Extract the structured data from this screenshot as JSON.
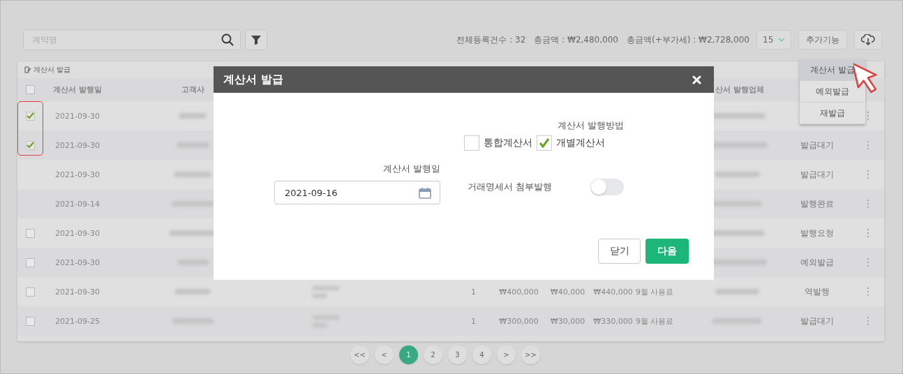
{
  "toolbar": {
    "search": {
      "placeholder": "계약명"
    },
    "stats": [
      "전체등록건수 : 32",
      "총금액 : ₩2,480,000",
      "총금액(+부가세) : ₩2,728,000"
    ],
    "page_size": "15",
    "more_button": "추가기능"
  },
  "table": {
    "action": "계산서 발급",
    "header": {
      "checked": false,
      "date": "계산서 발행일",
      "client": "고객사",
      "issuer": "산서 발행업체"
    },
    "rows": [
      {
        "has_checkbox": true,
        "checked": true,
        "date": "2021-09-30"
      },
      {
        "has_checkbox": true,
        "checked": true,
        "date": "2021-09-30",
        "status": "발급대기"
      },
      {
        "has_checkbox": false,
        "date": "2021-09-30",
        "status": "발급대기"
      },
      {
        "has_checkbox": false,
        "date": "2021-09-14",
        "status": "발행완료"
      },
      {
        "has_checkbox": true,
        "checked": false,
        "date": "2021-09-30",
        "status": "발행요청"
      },
      {
        "has_checkbox": true,
        "checked": false,
        "date": "2021-09-30",
        "status": "예외발급"
      },
      {
        "has_checkbox": true,
        "checked": false,
        "date": "2021-09-30",
        "qty": "1",
        "supply": "₩400,000",
        "tax": "₩40,000",
        "total": "₩440,000",
        "item": "9월 사용료",
        "status": "역발행"
      },
      {
        "has_checkbox": true,
        "checked": false,
        "date": "2021-09-25",
        "qty": "1",
        "supply": "₩300,000",
        "tax": "₩30,000",
        "total": "₩330,000",
        "item": "9월 사용료",
        "status": "발급대기"
      }
    ]
  },
  "pagination": {
    "first": "<<",
    "prev": "<",
    "pages": [
      {
        "label": "1",
        "selected": true
      },
      {
        "label": "2",
        "selected": false
      },
      {
        "label": "3",
        "selected": false
      },
      {
        "label": "4",
        "selected": false
      }
    ],
    "next": ">",
    "last": ">>"
  },
  "dropdown": {
    "items": [
      {
        "label": "계산서 발급",
        "selected": true
      },
      {
        "label": "예외발급",
        "selected": false
      },
      {
        "label": "재발급",
        "selected": false
      }
    ]
  },
  "modal": {
    "title": "계산서 발급",
    "date_label": "계산서 발행일",
    "date_value": "2021-09-16",
    "method_label": "계산서 발행방법",
    "methods": [
      {
        "label": "통합계산서",
        "checked": false
      },
      {
        "label": "개별계산서",
        "checked": true
      }
    ],
    "attach": {
      "label": "거래명세서 첨부발행",
      "on": false
    },
    "buttons": {
      "close": "닫기",
      "next": "다음"
    }
  }
}
